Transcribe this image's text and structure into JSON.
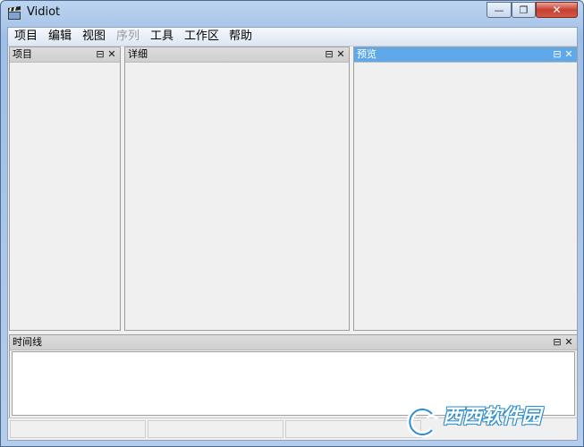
{
  "window": {
    "title": "Vidiot",
    "controls": {
      "minimize_glyph": "—",
      "restore_glyph": "❐",
      "close_glyph": "✕"
    }
  },
  "menubar": {
    "items": [
      {
        "label": "项目",
        "enabled": true
      },
      {
        "label": "编辑",
        "enabled": true
      },
      {
        "label": "视图",
        "enabled": true
      },
      {
        "label": "序列",
        "enabled": false
      },
      {
        "label": "工具",
        "enabled": true
      },
      {
        "label": "工作区",
        "enabled": true
      },
      {
        "label": "帮助",
        "enabled": true
      }
    ]
  },
  "panes": {
    "project": {
      "title": "项目"
    },
    "details": {
      "title": "详细"
    },
    "preview": {
      "title": "预览",
      "active": true
    },
    "timeline": {
      "title": "时间线"
    }
  },
  "pane_buttons": {
    "float_glyph": "⊟",
    "close_glyph": "✕"
  },
  "watermark": {
    "brand": "西西软件园",
    "domain": "CR173.COM"
  },
  "colors": {
    "active_header": "#5fa9ea",
    "close_button": "#c8402f"
  }
}
